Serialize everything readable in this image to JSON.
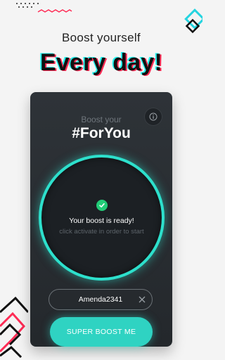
{
  "header": {
    "tagline": "Boost yourself",
    "hero": "Every day!"
  },
  "card": {
    "subtitle": "Boost your",
    "title": "#ForYou",
    "status": "Your boost is ready!",
    "hint": "click activate in order to start",
    "username": "Amenda2341",
    "button": "SUPER BOOST ME"
  },
  "colors": {
    "accent": "#2fd3c2",
    "brand_cyan": "#25f4ee",
    "brand_red": "#fe2c55",
    "success": "#22cc77",
    "card_bg": "#2a2e32"
  },
  "icons": {
    "info": "info-icon",
    "check": "check-icon",
    "clear": "close-icon"
  }
}
